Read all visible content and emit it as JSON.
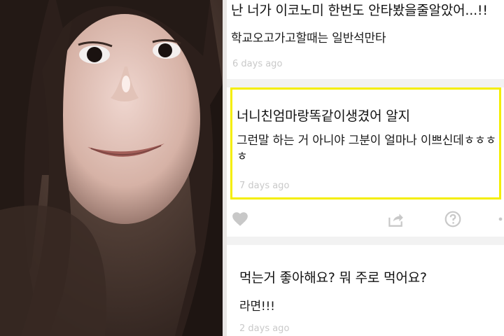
{
  "posts": [
    {
      "question": "난 너가 이코노미 한번도 안타봤을줄알았어...!!",
      "answer": "학교오고가고할때는 일반석만타",
      "time": "6 days ago"
    },
    {
      "question": "너니친엄마랑똑같이생겼어 알지",
      "answer": "그런말 하는 거 아니야 그분이 얼마나 이쁘신데ㅎㅎㅎㅎ",
      "time": "7 days ago",
      "highlight_color": "#f4ee00"
    },
    {
      "question": "먹는거 좋아해요? 뭐 주로 먹어요?",
      "answer": "라면!!!",
      "time": "2 days ago"
    }
  ],
  "actions": {
    "icons": [
      "heart-icon",
      "share-icon",
      "question-icon",
      "more-icon"
    ],
    "color": "#c8c8c8"
  }
}
